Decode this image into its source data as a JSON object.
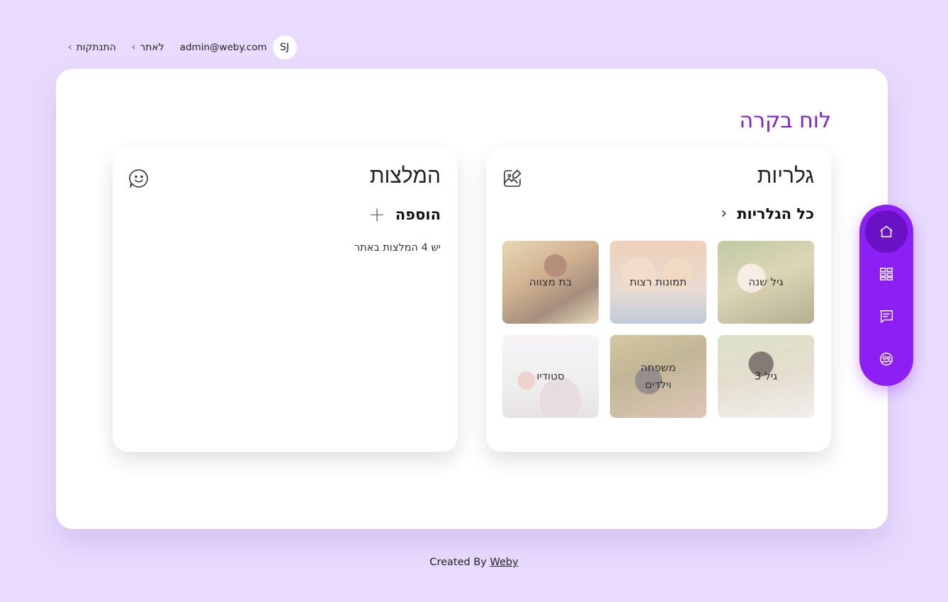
{
  "topbar": {
    "avatar_initials": "SJ",
    "email": "admin@weby.com",
    "site_link": "לאתר",
    "logout_link": "התנתקות"
  },
  "page": {
    "title": "לוח בקרה"
  },
  "galleries": {
    "title": "גלריות",
    "icon": "image-edit-icon",
    "all_link": "כל הגלריות",
    "items": [
      {
        "label": "גיל שנה"
      },
      {
        "label": "תמונות רצות"
      },
      {
        "label": "בת מצווה"
      },
      {
        "label": "גיל 3"
      },
      {
        "label": "משפחה וילדים"
      },
      {
        "label": "סטודיו"
      }
    ]
  },
  "recommendations": {
    "title": "המלצות",
    "icon": "smile-chat-icon",
    "add_label": "הוספה",
    "count_note": "יש 4 המלצות באתר"
  },
  "sidenav": {
    "items": [
      "home-icon",
      "grid-icon",
      "note-icon",
      "users-icon"
    ],
    "active": "home-icon",
    "color": "#8c1ff3"
  },
  "footer": {
    "prefix": "Created By",
    "link": "Weby"
  }
}
